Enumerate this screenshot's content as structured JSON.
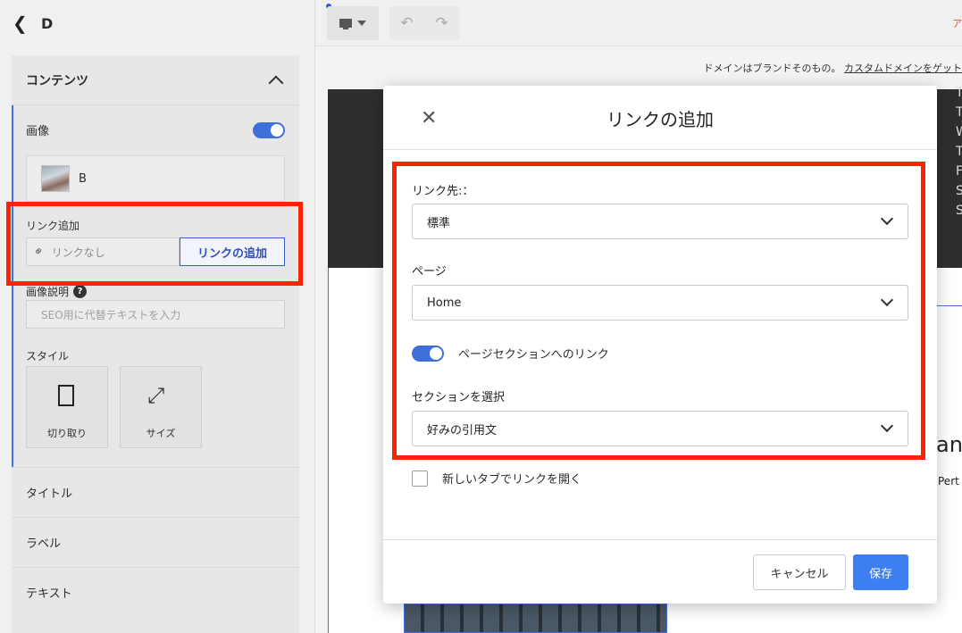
{
  "sidebar": {
    "back_icon": "chevron-left-icon",
    "title": "D",
    "contents_header": "コンテンツ",
    "image_label": "画像",
    "image_toggle_on": true,
    "image_name": "B",
    "link_label": "リンク追加",
    "link_none": "リンクなし",
    "link_add_button": "リンクの追加",
    "desc_label": "画像説明",
    "desc_help": "?",
    "desc_placeholder": "SEO用に代替テキストを入力",
    "style_label": "スタイル",
    "style_crop": "切り取り",
    "style_size": "サイズ",
    "sections": [
      "タイトル",
      "ラベル",
      "テキスト"
    ]
  },
  "topbar": {
    "right_text": "ア",
    "banner_text": "ドメインはブランドそのもの。",
    "banner_link": "カスタムドメインをゲット"
  },
  "canvas": {
    "dark_letters": [
      "T",
      "T",
      "W",
      "T",
      "F",
      "S",
      "S"
    ],
    "big_text": "ans",
    "small_text": "Pert"
  },
  "dialog": {
    "title": "リンクの追加",
    "link_target_label": "リンク先:：",
    "link_target_value": "標準",
    "page_label": "ページ",
    "page_value": "Home",
    "section_link_toggle_label": "ページセクションへのリンク",
    "section_link_toggle_on": true,
    "section_select_label": "セクションを選択",
    "section_select_value": "好みの引用文",
    "new_tab_label": "新しいタブでリンクを開く",
    "new_tab_checked": false,
    "cancel_button": "キャンセル",
    "save_button": "保存"
  },
  "colors": {
    "accent": "#3d7ef0",
    "highlight_border": "#ff2200",
    "sidebar_link_button": "#2f4fb5"
  }
}
